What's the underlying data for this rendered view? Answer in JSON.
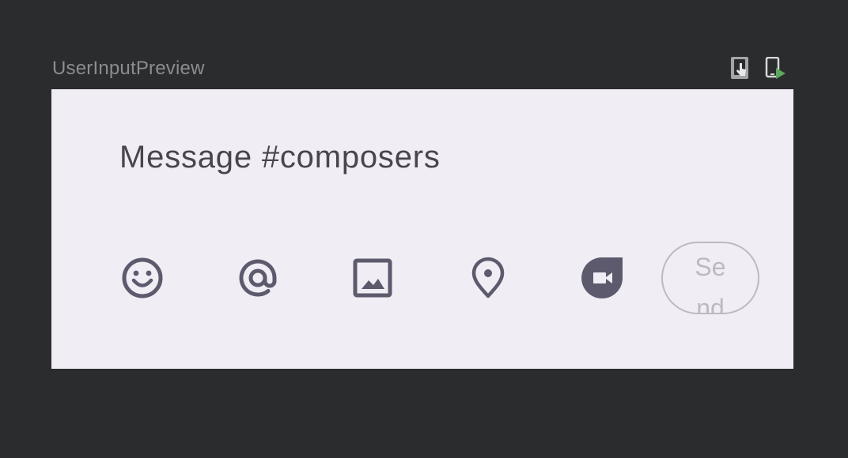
{
  "preview": {
    "title": "UserInputPreview",
    "toolbar_icons": [
      "interactive-mode-icon",
      "deploy-preview-icon"
    ]
  },
  "input": {
    "placeholder": "Message #composers"
  },
  "actions": {
    "icons": [
      "emoji-icon",
      "mention-icon",
      "image-icon",
      "location-icon",
      "video-call-icon"
    ],
    "send_label": "Send"
  },
  "colors": {
    "background": "#2b2c2e",
    "preview_surface": "#f0edf5",
    "icon": "#5d5a6d",
    "text": "#48454f",
    "disabled": "#bcbac1",
    "deploy_accent": "#5da85d"
  }
}
